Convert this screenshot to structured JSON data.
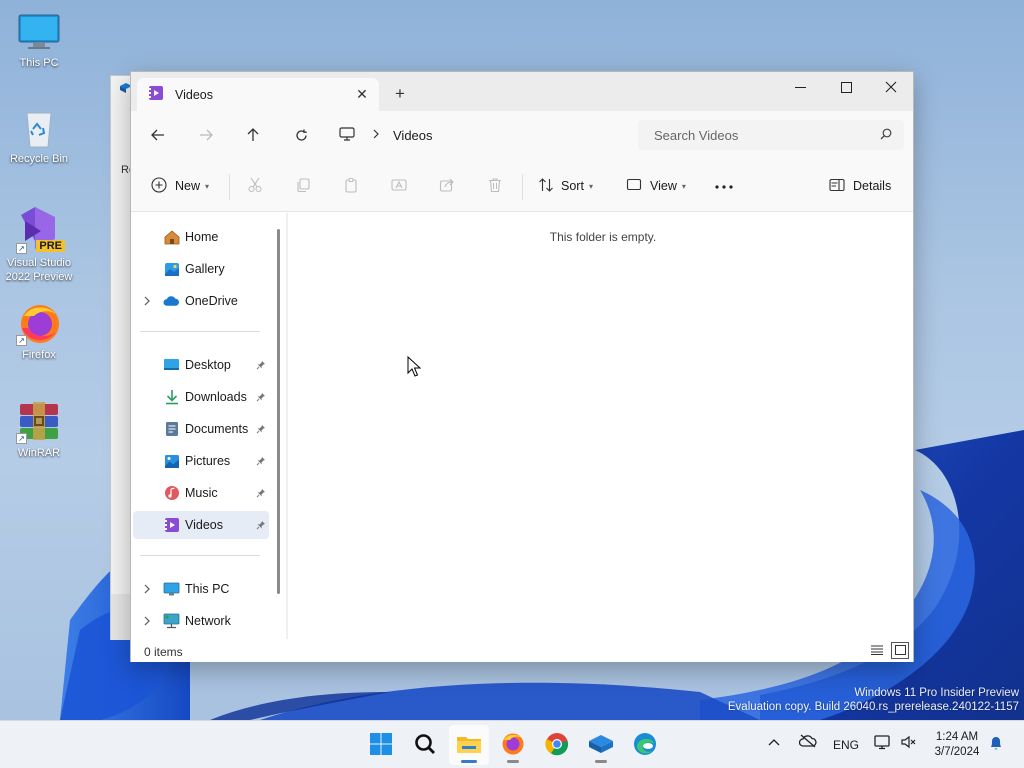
{
  "desktop": {
    "icons": [
      {
        "name": "This PC"
      },
      {
        "name": "Recycle Bin"
      },
      {
        "name": "Visual Studio 2022 Preview",
        "line1": "Visual Studio",
        "line2": "2022 Preview",
        "badge": "PRE"
      },
      {
        "name": "Firefox"
      },
      {
        "name": "WinRAR"
      }
    ],
    "background_window_text": "Re"
  },
  "explorer": {
    "tab_title": "Videos",
    "address": {
      "crumb": "Videos"
    },
    "search": {
      "placeholder": "Search Videos"
    },
    "toolbar": {
      "new_label": "New",
      "sort_label": "Sort",
      "view_label": "View",
      "details_label": "Details"
    },
    "nav": {
      "home": "Home",
      "gallery": "Gallery",
      "onedrive": "OneDrive",
      "desktop": "Desktop",
      "downloads": "Downloads",
      "documents": "Documents",
      "pictures": "Pictures",
      "music": "Music",
      "videos": "Videos",
      "thispc": "This PC",
      "network": "Network"
    },
    "empty_message": "This folder is empty.",
    "status": {
      "items": "0 items"
    }
  },
  "watermark": {
    "line1": "Windows 11 Pro Insider Preview",
    "line2": "Evaluation copy. Build 26040.rs_prerelease.240122-1157"
  },
  "taskbar": {
    "language": "ENG",
    "time": "1:24 AM",
    "date": "3/7/2024"
  },
  "colors": {
    "accent": "#0067c0",
    "selected_nav": "#e5ecf6",
    "taskbar": "#eef1f5"
  }
}
